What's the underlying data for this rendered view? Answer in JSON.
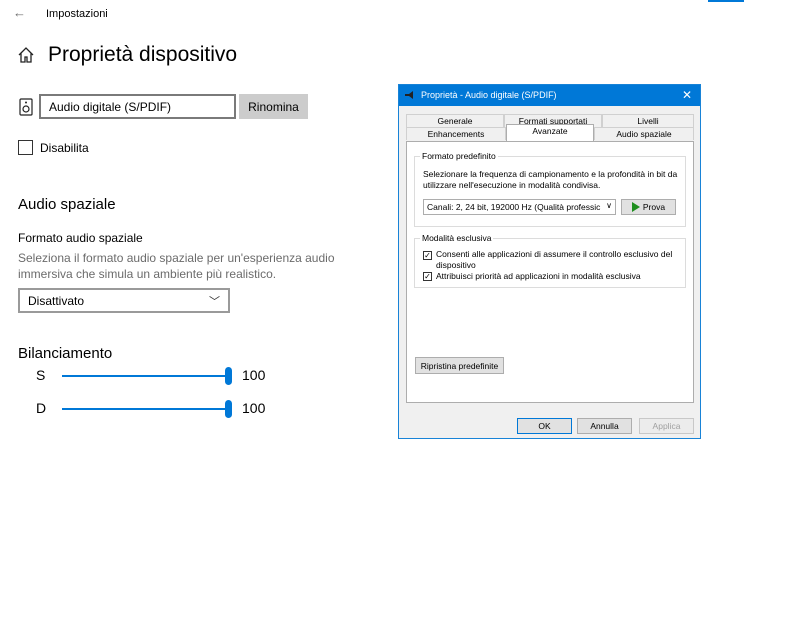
{
  "app": {
    "title": "Impostazioni",
    "back_glyph": "←"
  },
  "page": {
    "title": "Proprietà dispositivo",
    "device_name": "Audio digitale (S/PDIF)",
    "rename_label": "Rinomina",
    "disable_label": "Disabilita",
    "disable_checked": false
  },
  "spatial": {
    "heading": "Audio spaziale",
    "field_label": "Formato audio spaziale",
    "help": "Seleziona il formato audio spaziale per un'esperienza audio immersiva che simula un ambiente più realistico.",
    "selected": "Disattivato",
    "chevron": "﹀"
  },
  "balance": {
    "heading": "Bilanciamento",
    "left_label": "S",
    "left_value": "100",
    "left_level": 1.0,
    "right_label": "D",
    "right_value": "100",
    "right_level": 1.0
  },
  "dialog": {
    "title": "Proprietà - Audio digitale (S/PDIF)",
    "close_glyph": "✕",
    "tabs": {
      "generale": "Generale",
      "formati": "Formati supportati",
      "livelli": "Livelli",
      "enhancements": "Enhancements",
      "avanzate": "Avanzate",
      "audio_spaziale": "Audio spaziale"
    },
    "active_tab": "Avanzate",
    "default_format": {
      "title": "Formato predefinito",
      "description": "Selezionare la frequenza di campionamento e la profondità in bit da utilizzare nell'esecuzione in modalità condivisa.",
      "selected": "Canali: 2, 24 bit, 192000 Hz (Qualità professic",
      "test_label": "Prova"
    },
    "exclusive": {
      "title": "Modalità esclusiva",
      "option1": "Consenti alle applicazioni di assumere il controllo esclusivo del dispositivo",
      "option1_checked": true,
      "option2": "Attribuisci priorità ad applicazioni in modalità esclusiva",
      "option2_checked": true,
      "check_glyph": "✓"
    },
    "restore_label": "Ripristina predefinite",
    "ok_label": "OK",
    "cancel_label": "Annulla",
    "apply_label": "Applica"
  },
  "colors": {
    "accent": "#0078d7",
    "button_gray": "#cccccc",
    "help_text": "#6b6b6b"
  },
  "icons": [
    "back-arrow-icon",
    "home-icon",
    "speaker-icon",
    "chevron-down-icon",
    "play-icon",
    "close-icon",
    "check-icon"
  ]
}
